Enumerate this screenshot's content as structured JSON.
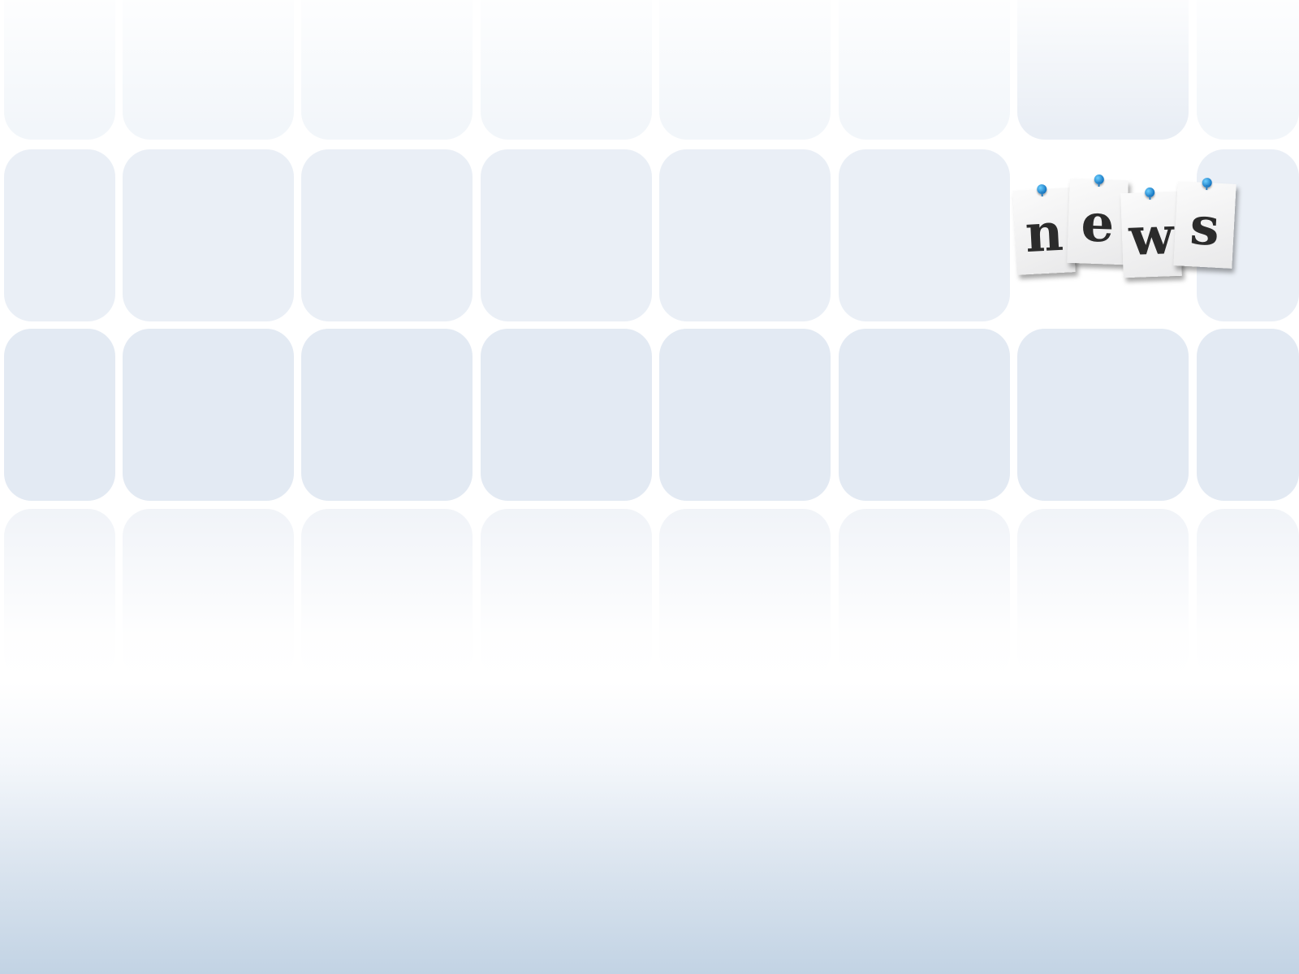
{
  "background": {
    "tile_color": "#e3eaf3",
    "gradient_bottom_color": "#c2d3e4",
    "page_color": "#ffffff"
  },
  "news_sign": {
    "letters": [
      "n",
      "e",
      "w",
      "s"
    ],
    "pin_color": "#1a8fdc",
    "paper_color": "#f2f2f2",
    "letter_color": "#2b2b2b"
  }
}
